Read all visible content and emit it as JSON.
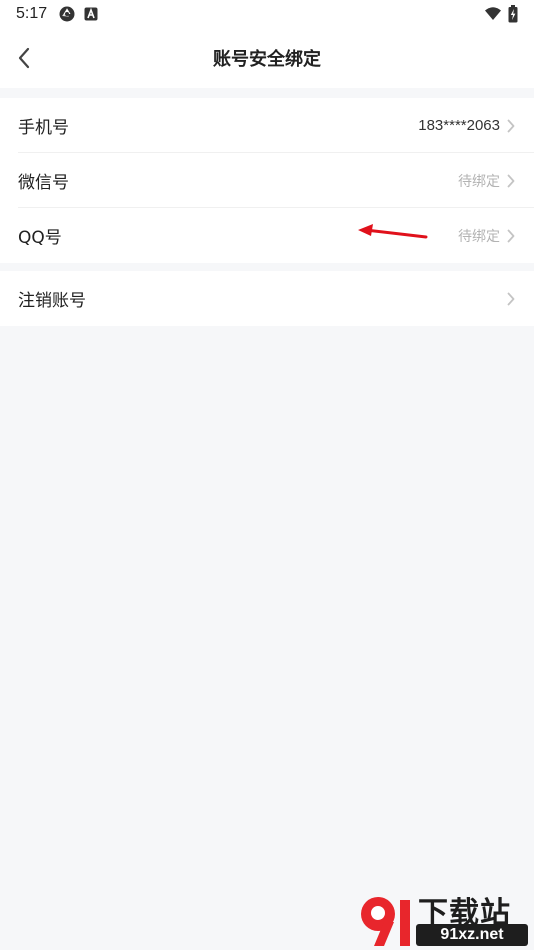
{
  "status_bar": {
    "time": "5:17",
    "left_icons": [
      "aperture-icon",
      "a-badge-icon"
    ],
    "right_icons": [
      "wifi-icon",
      "battery-charging-icon"
    ]
  },
  "header": {
    "title": "账号安全绑定",
    "back_icon": "chevron-left-icon"
  },
  "bindings": [
    {
      "label": "手机号",
      "value": "183****2063",
      "state": "bound"
    },
    {
      "label": "微信号",
      "value": "待绑定",
      "state": "pending"
    },
    {
      "label": "QQ号",
      "value": "待绑定",
      "state": "pending"
    }
  ],
  "account_actions": [
    {
      "label": "注销账号"
    }
  ],
  "annotation": {
    "type": "red-arrow",
    "color": "#e0111b"
  },
  "watermark": {
    "text_cn": "下载站",
    "domain": "91xz.net",
    "mark": "91",
    "accent": "#e8262c"
  },
  "colors": {
    "background": "#f6f7f9",
    "surface": "#ffffff",
    "text": "#222222",
    "muted": "#b3b3b3",
    "chevron": "#c4c4c4"
  }
}
